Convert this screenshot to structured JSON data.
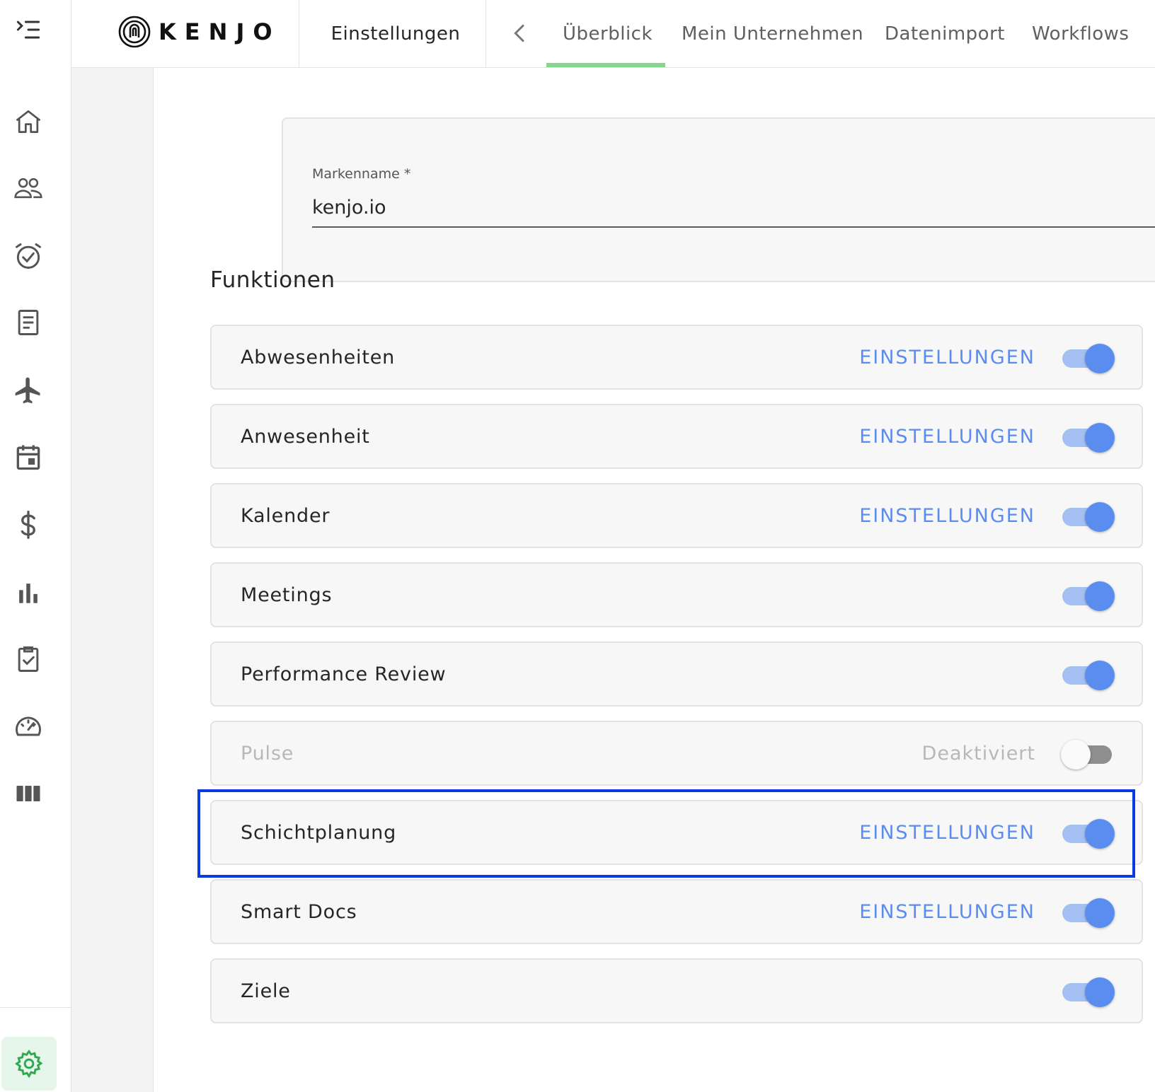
{
  "header": {
    "logo_text": "KENJO",
    "section": "Einstellungen",
    "tabs": [
      {
        "label": "Überblick",
        "active": true
      },
      {
        "label": "Mein Unternehmen"
      },
      {
        "label": "Datenimport"
      },
      {
        "label": "Workflows"
      }
    ]
  },
  "rail": {
    "icons": [
      "menu-icon",
      "home-icon",
      "people-icon",
      "alarm-check-icon",
      "document-icon",
      "airplane-icon",
      "calendar-icon",
      "dollar-icon",
      "bar-chart-icon",
      "clipboard-check-icon",
      "gauge-icon",
      "columns-icon"
    ],
    "settings_icon": "gear-icon",
    "settings_color": "#2fa84f"
  },
  "brand": {
    "label": "Markenname *",
    "value": "kenjo.io"
  },
  "functions": {
    "title": "Funktionen",
    "items": [
      {
        "name": "Abwesenheiten",
        "action": "EINSTELLUNGEN",
        "enabled": true
      },
      {
        "name": "Anwesenheit",
        "action": "EINSTELLUNGEN",
        "enabled": true
      },
      {
        "name": "Kalender",
        "action": "EINSTELLUNGEN",
        "enabled": true
      },
      {
        "name": "Meetings",
        "action": "",
        "enabled": true
      },
      {
        "name": "Performance Review",
        "action": "",
        "enabled": true
      },
      {
        "name": "Pulse",
        "action": "Deaktiviert",
        "enabled": false
      },
      {
        "name": "Schichtplanung",
        "action": "EINSTELLUNGEN",
        "enabled": true,
        "highlighted": true
      },
      {
        "name": "Smart Docs",
        "action": "EINSTELLUNGEN",
        "enabled": true
      },
      {
        "name": "Ziele",
        "action": "",
        "enabled": true
      }
    ]
  },
  "colors": {
    "accent": "#5b8def",
    "tab_underline": "#7fd88e",
    "highlight_box": "#0a3be0"
  }
}
